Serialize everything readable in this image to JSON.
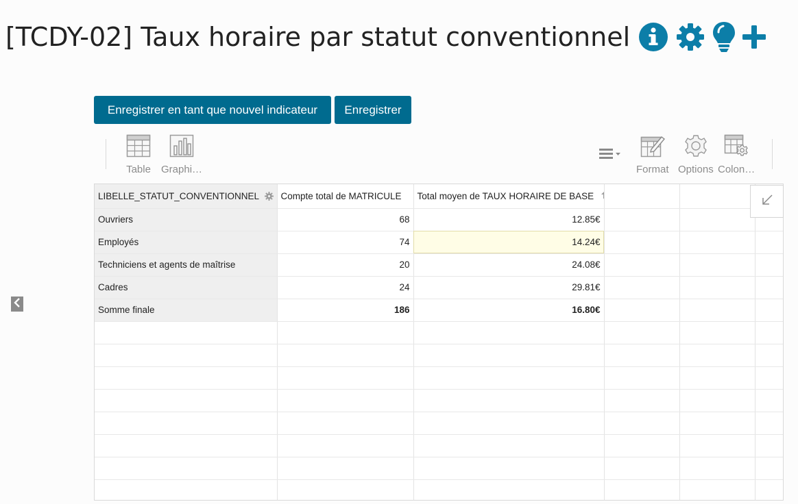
{
  "page": {
    "title": "[TCDY-02] Taux horaire par statut conventionnel",
    "title_icons": [
      "info-icon",
      "gear-icon",
      "lightbulb-icon",
      "plus-icon"
    ],
    "accent_color": "#006b8f"
  },
  "buttons": {
    "save_new": "Enregistrer en tant que nouvel indicateur",
    "save": "Enregistrer"
  },
  "toolbar": {
    "left": [
      {
        "label": "Table",
        "icon": "table-icon"
      },
      {
        "label": "Graphi…",
        "icon": "bar-chart-icon"
      }
    ],
    "right": [
      {
        "label": "",
        "icon": "menu-dropdown-icon"
      },
      {
        "label": "Format",
        "icon": "format-icon"
      },
      {
        "label": "Options",
        "icon": "gear-icon"
      },
      {
        "label": "Colon…",
        "icon": "columns-settings-icon"
      }
    ]
  },
  "pivot": {
    "row_header": "LIBELLE_STATUT_CONVENTIONNEL",
    "columns": [
      "Compte total de MATRICULE",
      "Total moyen de TAUX HORAIRE DE BASE"
    ],
    "rows": [
      {
        "label": "Ouvriers",
        "count": "68",
        "avg": "12.85€"
      },
      {
        "label": "Employés",
        "count": "74",
        "avg": "14.24€"
      },
      {
        "label": "Techniciens et agents de maîtrise",
        "count": "20",
        "avg": "24.08€"
      },
      {
        "label": "Cadres",
        "count": "24",
        "avg": "29.81€"
      }
    ],
    "total": {
      "label": "Somme finale",
      "count": "186",
      "avg": "16.80€"
    },
    "highlighted_row": "Employés"
  }
}
